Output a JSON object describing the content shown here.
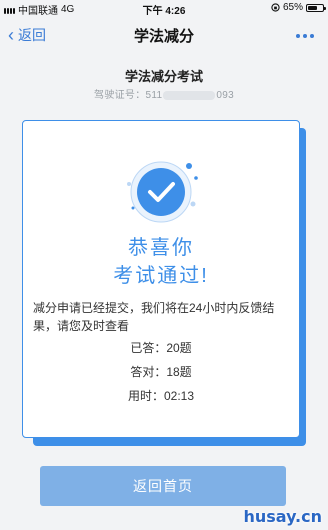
{
  "status": {
    "carrier": "中国联通",
    "network": "4G",
    "time": "下午 4:26",
    "battery": "65%",
    "battery_level": 0.65
  },
  "nav": {
    "back_label": "返回",
    "title": "学法减分"
  },
  "exam": {
    "title": "学法减分考试",
    "license_prefix": "驾驶证号：",
    "license_start": "511",
    "license_end": "093"
  },
  "result": {
    "congrats": "恭喜你",
    "passed": "考试通过!",
    "message": "减分申请已经提交，我们将在24小时内反馈结果，请您及时查看",
    "answered_label": "已答：",
    "answered_value": "20题",
    "correct_label": "答对：",
    "correct_value": "18题",
    "time_label": "用时：",
    "time_value": "02:13"
  },
  "actions": {
    "home_label": "返回首页"
  },
  "watermark": "husay.cn",
  "colors": {
    "accent": "#3e8fe8",
    "button": "#7fb0e6",
    "nav_link": "#3a7bd5"
  }
}
